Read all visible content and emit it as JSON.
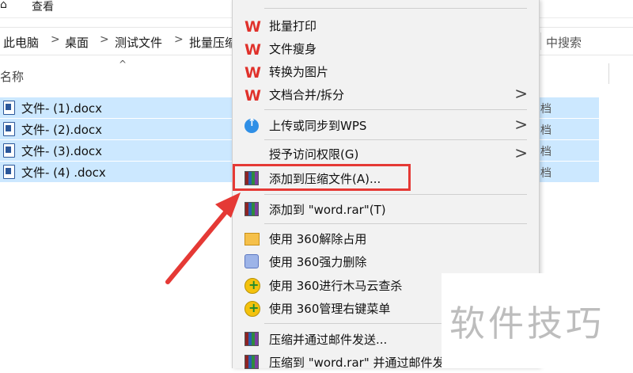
{
  "menubar": {
    "left_label": "⌂",
    "view": "查看"
  },
  "breadcrumb": [
    "此电脑",
    "桌面",
    "测试文件",
    "批量压缩"
  ],
  "breadcrumb_sep": ">",
  "search_placeholder": "中搜索",
  "column_header": "名称",
  "sort_arrow": "^",
  "files": [
    {
      "name": "文件- (1).docx",
      "type": "档"
    },
    {
      "name": "文件- (2).docx",
      "type": "档"
    },
    {
      "name": "文件- (3).docx",
      "type": "档"
    },
    {
      "name": "文件- (4) .docx",
      "type": "档"
    }
  ],
  "context_menu": {
    "items": [
      {
        "label": "批量打印",
        "icon": "wps-icon"
      },
      {
        "label": "文件瘦身",
        "icon": "wps-icon"
      },
      {
        "label": "转换为图片",
        "icon": "wps-icon"
      },
      {
        "label": "文档合并/拆分",
        "icon": "wps-icon"
      },
      {
        "label": "上传或同步到WPS",
        "icon": "cloud-upload-icon"
      },
      {
        "label": "授予访问权限(G)",
        "icon": ""
      },
      {
        "label": "添加到压缩文件(A)...",
        "icon": "winrar-icon"
      },
      {
        "label": "添加到 \"word.rar\"(T)",
        "icon": "winrar-icon"
      },
      {
        "label": "使用 360解除占用",
        "icon": "360-unlock-icon"
      },
      {
        "label": "使用 360强力删除",
        "icon": "360-shred-icon"
      },
      {
        "label": "使用 360进行木马云查杀",
        "icon": "360-scan-icon"
      },
      {
        "label": "使用 360管理右键菜单",
        "icon": "360-menu-icon"
      },
      {
        "label": "压缩并通过邮件发送...",
        "icon": "winrar-icon"
      },
      {
        "label": "压缩到 \"word.rar\" 并通过邮件发",
        "icon": "winrar-icon"
      }
    ],
    "submenu_chevron": ">",
    "wps_glyph": "W"
  },
  "highlight_color": "#e53935",
  "selection_color": "#cce8ff",
  "watermark": "软件技巧"
}
